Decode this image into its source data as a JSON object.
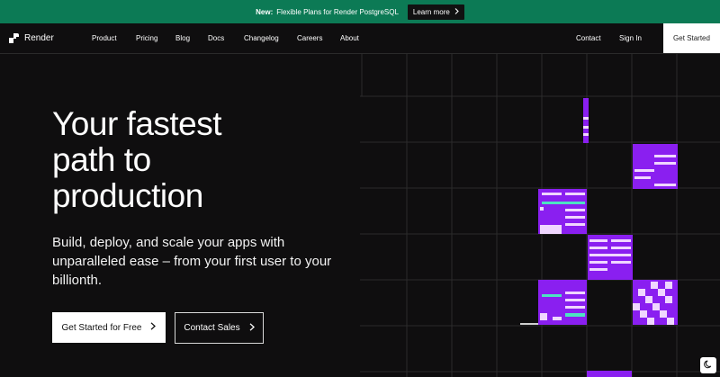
{
  "banner": {
    "prefix": "New:",
    "text": "Flexible Plans for Render PostgreSQL",
    "cta": "Learn more"
  },
  "nav": {
    "brand": "Render",
    "links": [
      "Product",
      "Pricing",
      "Blog",
      "Docs",
      "Changelog",
      "Careers",
      "About"
    ],
    "contact": "Contact",
    "sign_in": "Sign In",
    "get_started": "Get Started"
  },
  "hero": {
    "title_lines": [
      "Your fastest",
      "path to",
      "production"
    ],
    "subtitle": "Build, deploy, and scale your apps with unparalleled ease – from your first user to your billionth.",
    "primary_cta": "Get Started for Free",
    "secondary_cta": "Contact Sales"
  },
  "colors": {
    "banner_green": "#0c7a55",
    "accent_purple": "#8a1ff0",
    "accent_teal": "#4de3c2",
    "background": "#0f0e0f"
  },
  "icons": [
    "logo-mark-icon",
    "chevron-right-icon",
    "moon-icon"
  ]
}
